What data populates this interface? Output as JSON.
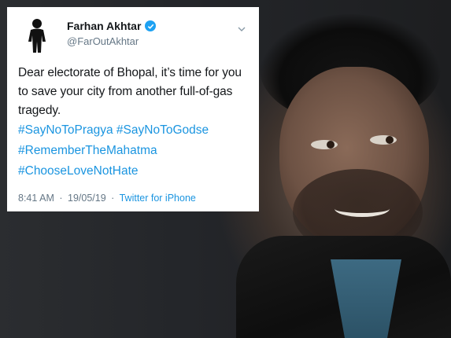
{
  "tweet": {
    "display_name": "Farhan Akhtar",
    "handle": "@FarOutAkhtar",
    "body": "Dear electorate of Bhopal, it’s time for you to save your city from another full-of-gas tragedy.",
    "hashtags": [
      "#SayNoToPragya #SayNoToGodse",
      "#RememberTheMahatma",
      "#ChooseLoveNotHate"
    ],
    "time": "8:41 AM",
    "separator1": "·",
    "date": "19/05/19",
    "separator2": "·",
    "source": "Twitter for iPhone"
  },
  "icons": {
    "verified": "verified-badge-icon",
    "more": "chevron-down-icon"
  },
  "colors": {
    "link": "#1b95e0",
    "verified": "#1da1f2",
    "muted": "#657786",
    "text": "#14171a"
  }
}
